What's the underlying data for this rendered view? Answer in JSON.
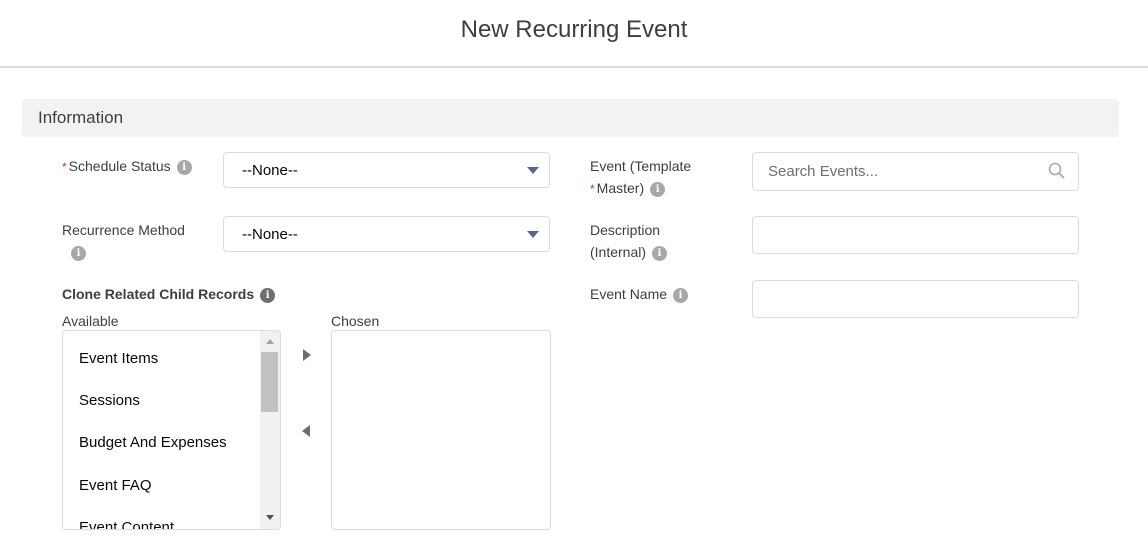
{
  "header": {
    "title": "New Recurring Event"
  },
  "section": {
    "title": "Information"
  },
  "left": {
    "schedule_status": {
      "label": "Schedule Status",
      "required": true,
      "value": "--None--"
    },
    "recurrence_method": {
      "label": "Recurrence Method",
      "value": "--None--"
    },
    "clone": {
      "label": "Clone Related Child Records",
      "available_label": "Available",
      "chosen_label": "Chosen",
      "available": [
        "Event Items",
        "Sessions",
        "Budget And Expenses",
        "Event FAQ",
        "Event Content"
      ],
      "chosen": []
    }
  },
  "right": {
    "event_template": {
      "label_line1": "Event (Template",
      "label_line2": "Master)",
      "required": true,
      "placeholder": "Search Events..."
    },
    "description": {
      "label_line1": "Description",
      "label_line2": "(Internal)",
      "value": ""
    },
    "event_name": {
      "label": "Event Name",
      "value": ""
    }
  },
  "icons": {
    "info": "info-icon",
    "search": "search-icon",
    "caret": "chevron-down-icon",
    "move_right": "triangle-right-icon",
    "move_left": "triangle-left-icon"
  },
  "colors": {
    "required": "#c23934",
    "section_bg": "#f3f2f2",
    "caret": "#54698d"
  }
}
